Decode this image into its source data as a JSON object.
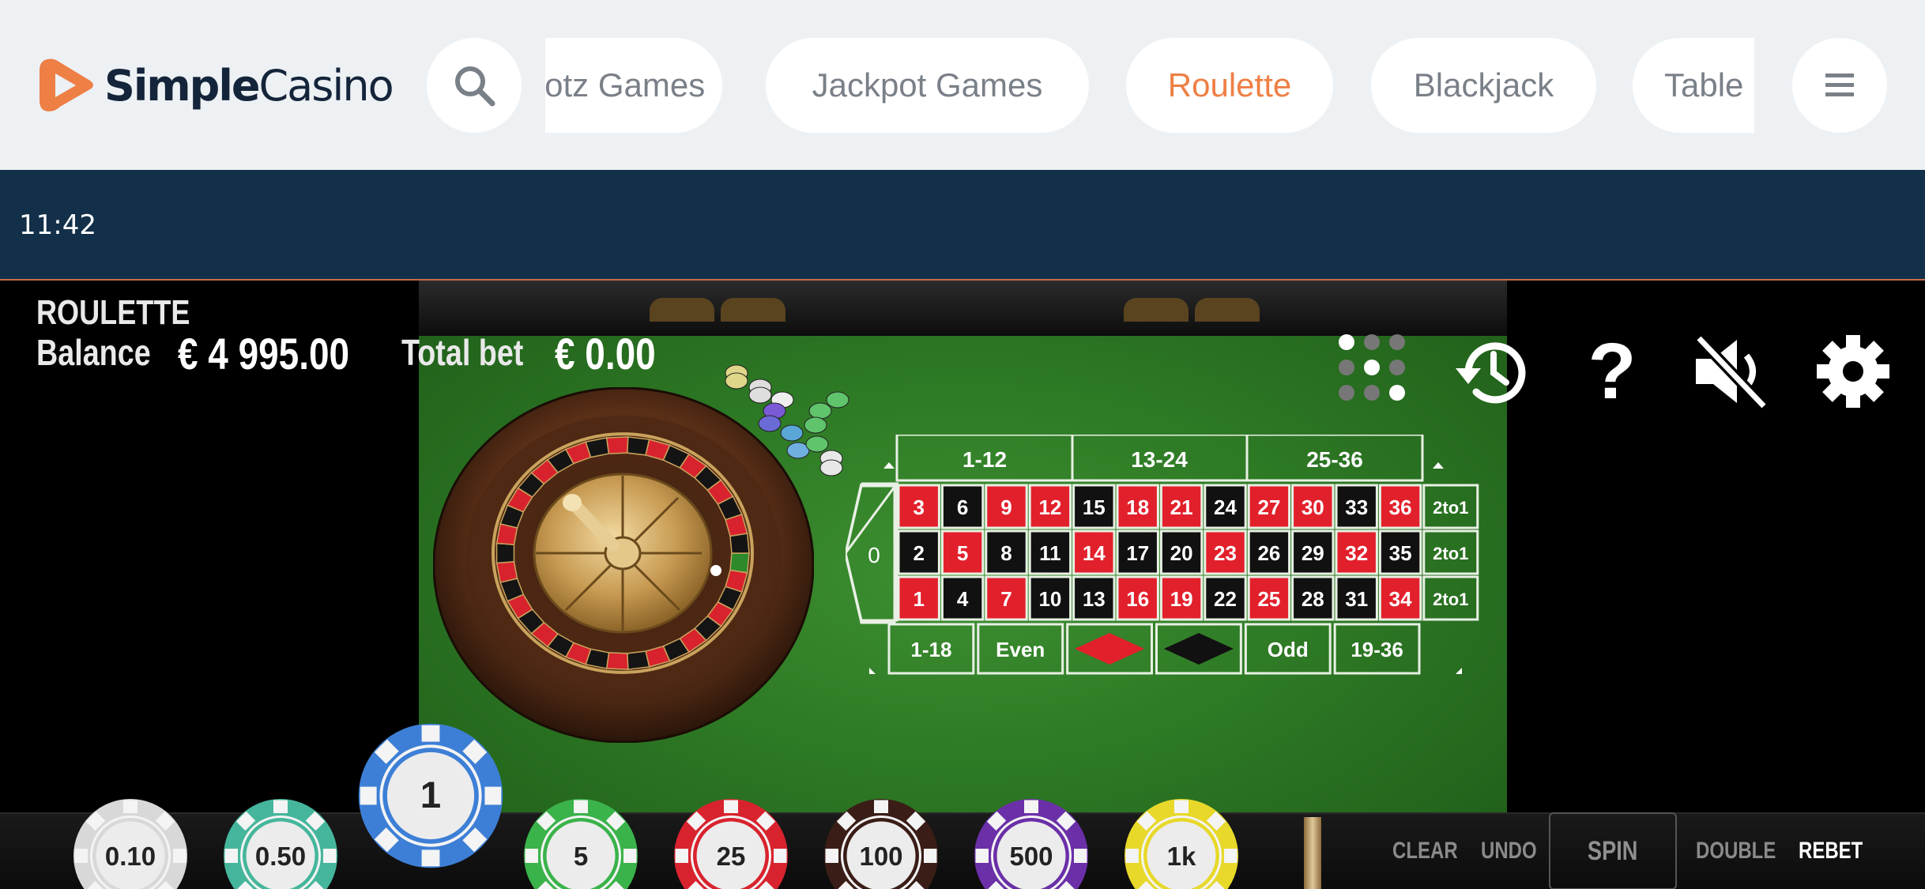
{
  "brand": {
    "name_bold": "Simple",
    "name_light": "Casino",
    "accent_color": "#ee7f45"
  },
  "nav": {
    "search_icon": "search-icon",
    "menu_icon": "hamburger-menu-icon",
    "categories": [
      {
        "label": "Slotz Games",
        "active": false
      },
      {
        "label": "Jackpot Games",
        "active": false
      },
      {
        "label": "Roulette",
        "active": true
      },
      {
        "label": "Blackjack",
        "active": false
      },
      {
        "label": "Table",
        "active": false
      }
    ]
  },
  "status": {
    "time": "11:42"
  },
  "game": {
    "title": "ROULETTE",
    "balance_label": "Balance",
    "balance_value": "€ 4 995.00",
    "total_bet_label": "Total bet",
    "total_bet_value": "€ 0.00",
    "controls": [
      "layout-dots-icon",
      "history-icon",
      "help-icon",
      "sound-muted-icon",
      "settings-gear-icon"
    ],
    "help_glyph": "?"
  },
  "board": {
    "zero": "0",
    "dozens": [
      "1-12",
      "13-24",
      "25-36"
    ],
    "column_bets": [
      "2to1",
      "2to1",
      "2to1"
    ],
    "red_numbers": [
      1,
      3,
      5,
      7,
      9,
      12,
      14,
      16,
      18,
      19,
      21,
      23,
      25,
      27,
      30,
      32,
      34,
      36
    ],
    "outside_bets": [
      "1-18",
      "Even",
      "",
      "",
      "Odd",
      "19-36"
    ],
    "colors": {
      "red": "#e2202c",
      "black": "#111111",
      "felt": "#2f7d26"
    }
  },
  "chips": [
    {
      "label": "0.10",
      "color": "#d8d8d8",
      "selected": false
    },
    {
      "label": "0.50",
      "color": "#45b69c",
      "selected": false
    },
    {
      "label": "1",
      "color": "#3d7fd6",
      "selected": true
    },
    {
      "label": "5",
      "color": "#3ab34a",
      "selected": false
    },
    {
      "label": "25",
      "color": "#d8232e",
      "selected": false
    },
    {
      "label": "100",
      "color": "#3a1d17",
      "selected": false
    },
    {
      "label": "500",
      "color": "#6b2fa8",
      "selected": false
    },
    {
      "label": "1k",
      "color": "#e7d82a",
      "selected": false
    }
  ],
  "actions": {
    "clear": "CLEAR",
    "undo": "UNDO",
    "spin": "SPIN",
    "double": "DOUBLE",
    "rebet": "REBET"
  }
}
